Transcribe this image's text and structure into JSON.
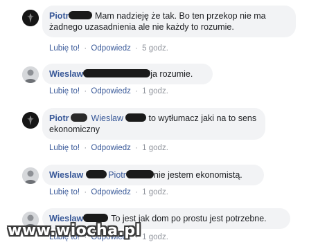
{
  "comments": [
    {
      "author": "Piotr",
      "text": "Mam nadzieję że tak. Bo ten przekop nie ma żadnego uzasadnienia ale nie każdy to rozumie.",
      "like": "Lubię to!",
      "reply": "Odpowiedz",
      "time": "5 godz."
    },
    {
      "author": "Wieslaw",
      "text": "ja rozumie.",
      "like": "Lubię to!",
      "reply": "Odpowiedz",
      "time": "1 godz."
    },
    {
      "author": "Piotr",
      "mention": "Wieslaw",
      "text_line1": "to wytłumacz jaki na to sens",
      "text_line2": "ekonomiczny",
      "like": "Lubię to!",
      "reply": "Odpowiedz",
      "time": "1 godz."
    },
    {
      "author": "Wieslaw",
      "mention": "Piotr",
      "text": "nie jestem ekonomistą.",
      "like": "Lubię to!",
      "reply": "Odpowiedz",
      "time": "1 godz."
    },
    {
      "author": "Wieslaw",
      "text": "To jest jak dom po prostu jest potrzebne.",
      "like": "Lubię to!",
      "reply": "Odpowiedz",
      "time": "1 godz."
    }
  ],
  "separator": "·",
  "watermark": "www.wiocha.pl",
  "icons": {
    "dark_avatar": "dark-emblem-avatar",
    "photo_avatar": "photo-avatar"
  },
  "colors": {
    "link": "#385898",
    "bubble": "#f2f3f5",
    "meta": "#90949c"
  }
}
